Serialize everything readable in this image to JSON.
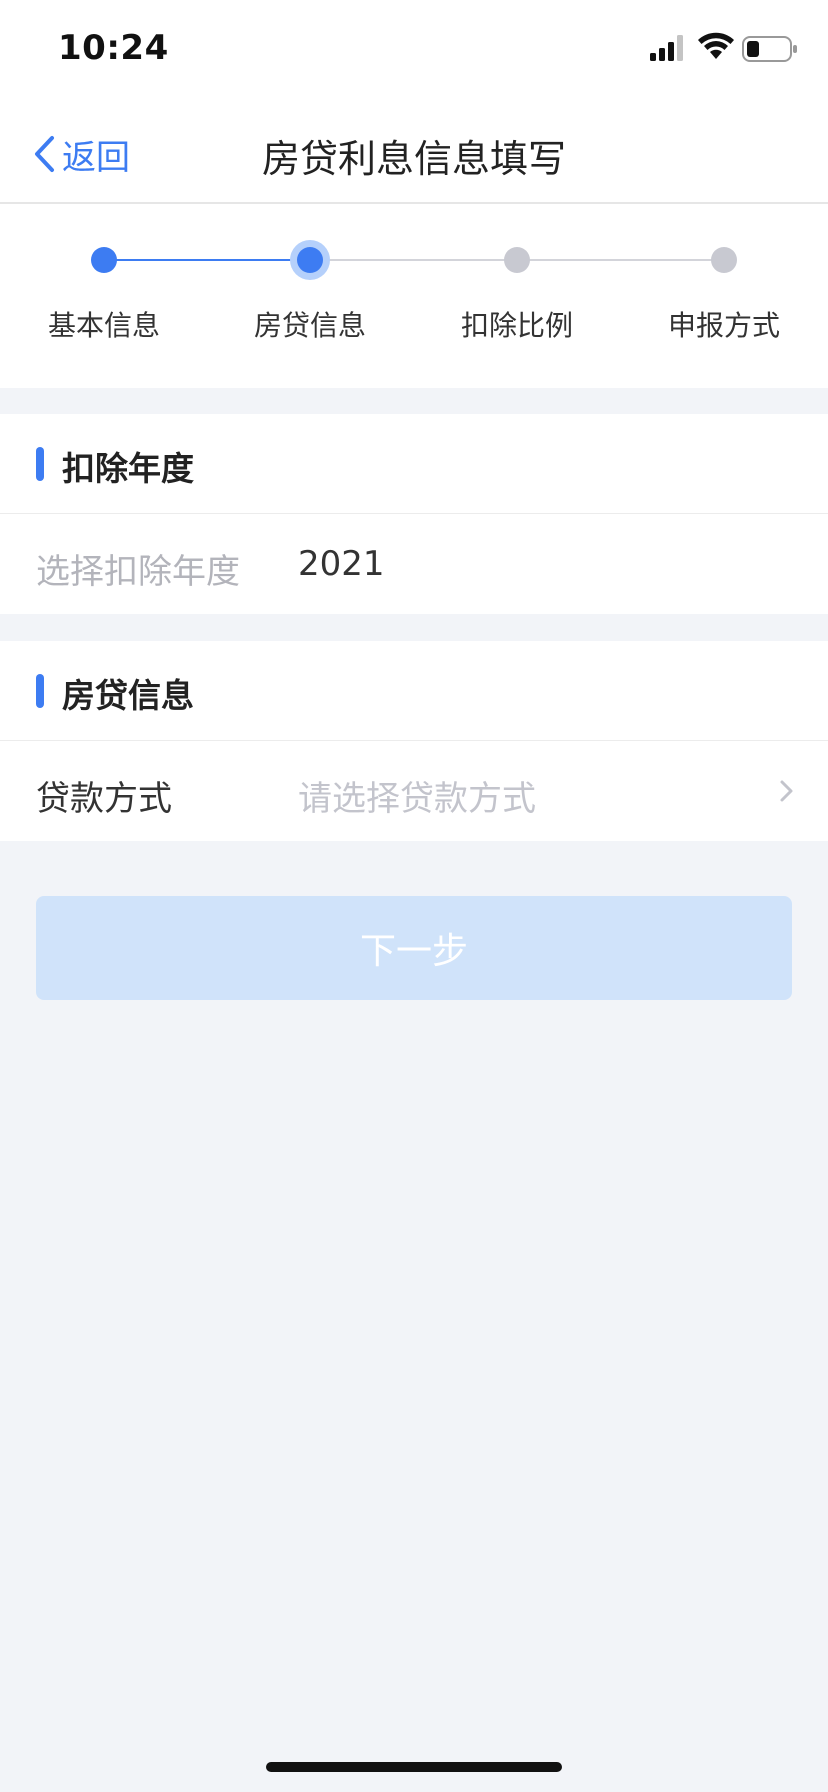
{
  "status_bar": {
    "time": "10:24"
  },
  "nav": {
    "back_label": "返回",
    "title": "房贷利息信息填写"
  },
  "steps": [
    {
      "label": "基本信息",
      "state": "done"
    },
    {
      "label": "房贷信息",
      "state": "active"
    },
    {
      "label": "扣除比例",
      "state": "pending"
    },
    {
      "label": "申报方式",
      "state": "pending"
    }
  ],
  "deduction_year": {
    "title": "扣除年度",
    "label": "选择扣除年度",
    "value": "2021"
  },
  "loan_info": {
    "title": "房贷信息",
    "label": "贷款方式",
    "placeholder": "请选择贷款方式"
  },
  "next_button": {
    "label": "下一步",
    "enabled": false
  },
  "colors": {
    "accent": "#3d7cf2",
    "disabled_button": "#d0e3fa",
    "pending_step": "#c8c9d1",
    "page_bg": "#f2f4f8"
  }
}
